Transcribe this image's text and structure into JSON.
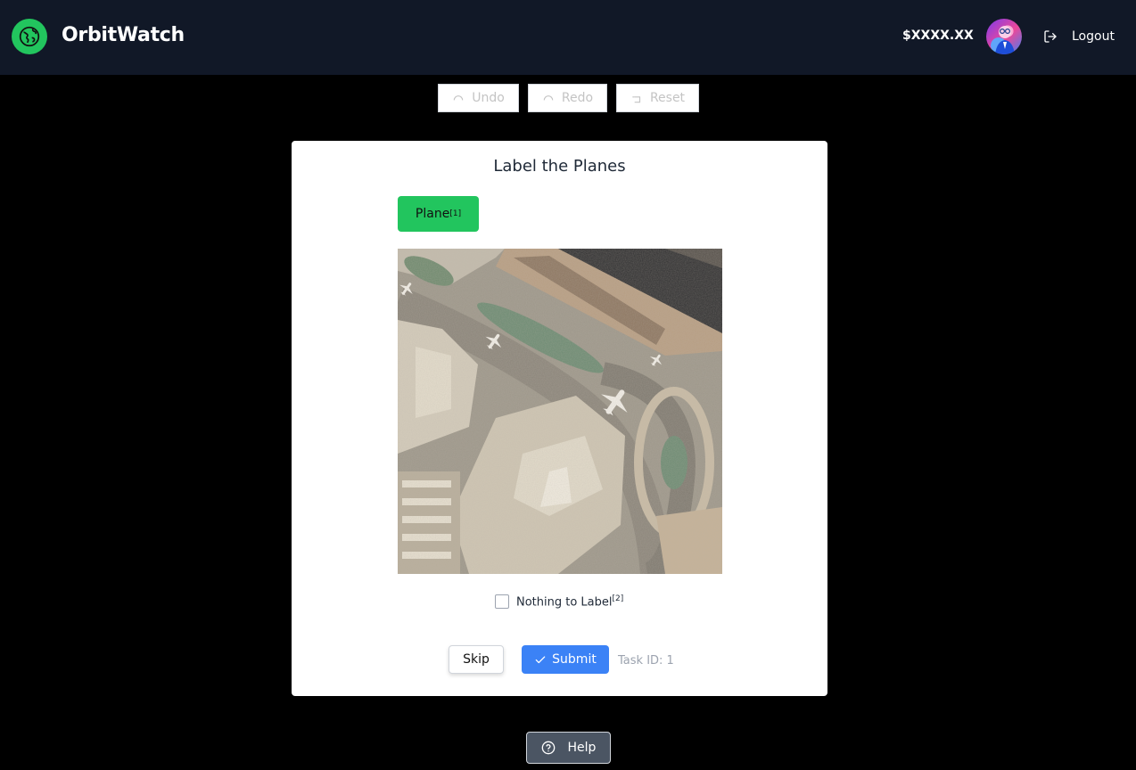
{
  "header": {
    "brand": "OrbitWatch",
    "balance": "$XXXX.XX",
    "logout_label": "Logout",
    "avatar_icon": "avatar-icon",
    "logo_icon": "globe-icon",
    "accent_color": "#22c55e"
  },
  "toolbar": {
    "undo_label": "Undo",
    "redo_label": "Redo",
    "reset_label": "Reset"
  },
  "task": {
    "title": "Label the Planes",
    "label_name": "Plane",
    "label_hotkey": "[1]",
    "nothing_label": "Nothing to Label",
    "nothing_hotkey": "[2]",
    "nothing_checked": false,
    "skip_label": "Skip",
    "submit_label": "Submit",
    "task_id": "Task ID: 1"
  },
  "footer": {
    "help_label": "Help"
  },
  "colors": {
    "header_bg": "#111827",
    "submit": "#3b82f6",
    "label_green": "#22c55e",
    "help_bg": "#4b5563"
  }
}
